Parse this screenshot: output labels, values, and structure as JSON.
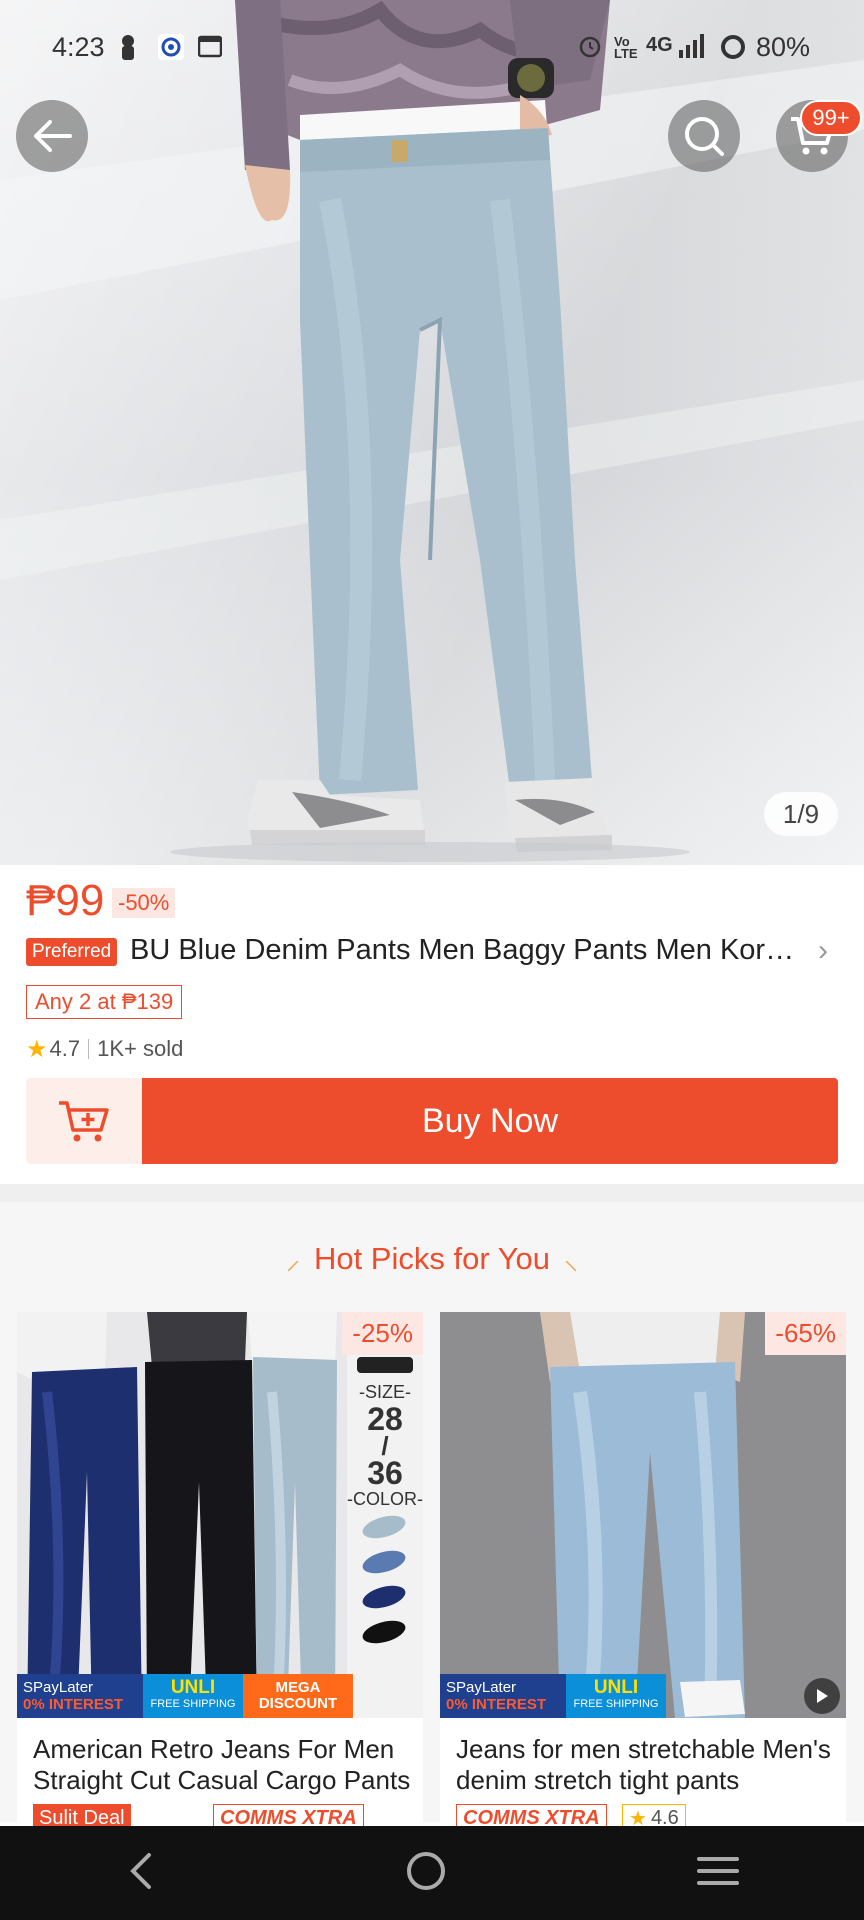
{
  "status_bar": {
    "time": "4:23",
    "network": "4G",
    "battery": "80%"
  },
  "hero": {
    "cart_badge": "99+",
    "image_counter": "1/9"
  },
  "product": {
    "price": "₱99",
    "discount": "-50%",
    "preferred_label": "Preferred",
    "title": "BU Blue Denim Pants Men Baggy Pants Men Korean Style",
    "promo": "Any 2 at ₱139",
    "rating": "4.7",
    "sold": "1K+ sold",
    "buy_now": "Buy Now"
  },
  "hot_picks": {
    "heading": "Hot Picks for You",
    "cards": [
      {
        "discount": "-25%",
        "title": "American Retro Jeans For Men Straight Cut Casual Cargo Pants",
        "size_label": "-SIZE-",
        "size_top": "28",
        "size_sep": "/",
        "size_bottom": "36",
        "color_label": "-COLOR-",
        "spay_top": "SPayLater",
        "spay_bottom": "0% INTEREST",
        "unli_top": "UNLI",
        "unli_bottom": "FREE SHIPPING",
        "mega_top": "MEGA",
        "mega_bottom": "DISCOUNT",
        "tag1": "Sulit Deal",
        "tag2": "COMMS XTRA"
      },
      {
        "discount": "-65%",
        "title": "Jeans for men stretchable Men's denim stretch tight pants",
        "spay_top": "SPayLater",
        "spay_bottom": "0% INTEREST",
        "unli_top": "UNLI",
        "unli_bottom": "FREE SHIPPING",
        "tag1": "COMMS XTRA",
        "tag2": "4.6"
      }
    ]
  },
  "colors": {
    "accent": "#ee4d2d",
    "accent_light": "#fde7e2",
    "star": "#ffb400"
  }
}
